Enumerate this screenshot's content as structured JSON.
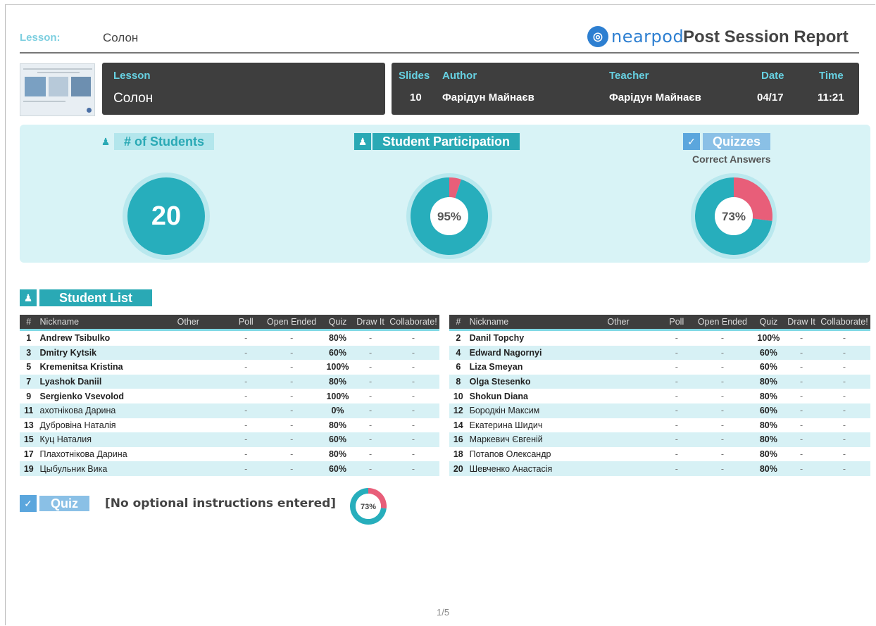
{
  "header": {
    "lesson_label": "Lesson:",
    "lesson_value": "Солон",
    "brand": "nearpod",
    "report_title": "Post Session Report"
  },
  "info": {
    "lesson_label": "Lesson",
    "lesson_value": "Солон",
    "slides_label": "Slides",
    "slides_value": "10",
    "author_label": "Author",
    "author_value": "Фарідун Майнаєв",
    "teacher_label": "Teacher",
    "teacher_value": "Фарідун Майнаєв",
    "date_label": "Date",
    "date_value": "04/17",
    "time_label": "Time",
    "time_value": "11:21"
  },
  "stats": {
    "students_label": "# of Students",
    "students_value": "20",
    "participation_label": "Student Participation",
    "participation_text": "95%",
    "participation_fraction": 0.95,
    "quizzes_label": "Quizzes",
    "quizzes_sub": "Correct Answers",
    "quizzes_text": "73%",
    "quizzes_fraction": 0.73
  },
  "colors": {
    "teal": "#2aa9b5",
    "pink": "#e85e79",
    "dark": "#3e3e3e",
    "light_teal": "#d8f3f6",
    "brand_blue": "#2d7fd1"
  },
  "student_list": {
    "title": "Student List",
    "columns": [
      "#",
      "Nickname",
      "Other",
      "Poll",
      "Open Ended",
      "Quiz",
      "Draw It",
      "Collaborate!"
    ],
    "left": [
      {
        "num": "1",
        "name": "Andrew Tsibulko",
        "bold": true,
        "other": "",
        "poll": "-",
        "open": "-",
        "quiz": "80%",
        "draw": "-",
        "collab": "-"
      },
      {
        "num": "3",
        "name": "Dmitry Kytsik",
        "bold": true,
        "other": "",
        "poll": "-",
        "open": "-",
        "quiz": "60%",
        "draw": "-",
        "collab": "-"
      },
      {
        "num": "5",
        "name": "Kremenitsa Kristina",
        "bold": true,
        "other": "",
        "poll": "-",
        "open": "-",
        "quiz": "100%",
        "draw": "-",
        "collab": "-"
      },
      {
        "num": "7",
        "name": "Lyashok Daniil",
        "bold": true,
        "other": "",
        "poll": "-",
        "open": "-",
        "quiz": "80%",
        "draw": "-",
        "collab": "-"
      },
      {
        "num": "9",
        "name": "Sergienko Vsevolod",
        "bold": true,
        "other": "",
        "poll": "-",
        "open": "-",
        "quiz": "100%",
        "draw": "-",
        "collab": "-"
      },
      {
        "num": "11",
        "name": "ахотнікова Дарина",
        "bold": false,
        "other": "",
        "poll": "-",
        "open": "-",
        "quiz": "0%",
        "draw": "-",
        "collab": "-"
      },
      {
        "num": "13",
        "name": "Дубровіна Наталія",
        "bold": false,
        "other": "",
        "poll": "-",
        "open": "-",
        "quiz": "80%",
        "draw": "-",
        "collab": "-"
      },
      {
        "num": "15",
        "name": "Куц Наталия",
        "bold": false,
        "other": "",
        "poll": "-",
        "open": "-",
        "quiz": "60%",
        "draw": "-",
        "collab": "-"
      },
      {
        "num": "17",
        "name": "Плахотнікова Дарина",
        "bold": false,
        "other": "",
        "poll": "-",
        "open": "-",
        "quiz": "80%",
        "draw": "-",
        "collab": "-"
      },
      {
        "num": "19",
        "name": "Цыбульник Вика",
        "bold": false,
        "other": "",
        "poll": "-",
        "open": "-",
        "quiz": "60%",
        "draw": "-",
        "collab": "-"
      }
    ],
    "right": [
      {
        "num": "2",
        "name": "Danil Topchy",
        "bold": true,
        "other": "",
        "poll": "-",
        "open": "-",
        "quiz": "100%",
        "draw": "-",
        "collab": "-"
      },
      {
        "num": "4",
        "name": "Edward Nagornyi",
        "bold": true,
        "other": "",
        "poll": "-",
        "open": "-",
        "quiz": "60%",
        "draw": "-",
        "collab": "-"
      },
      {
        "num": "6",
        "name": "Liza Smeyan",
        "bold": true,
        "other": "",
        "poll": "-",
        "open": "-",
        "quiz": "60%",
        "draw": "-",
        "collab": "-"
      },
      {
        "num": "8",
        "name": "Olga Stesenko",
        "bold": true,
        "other": "",
        "poll": "-",
        "open": "-",
        "quiz": "80%",
        "draw": "-",
        "collab": "-"
      },
      {
        "num": "10",
        "name": "Shokun Diana",
        "bold": true,
        "other": "",
        "poll": "-",
        "open": "-",
        "quiz": "80%",
        "draw": "-",
        "collab": "-"
      },
      {
        "num": "12",
        "name": "Бородкін Максим",
        "bold": false,
        "other": "",
        "poll": "-",
        "open": "-",
        "quiz": "60%",
        "draw": "-",
        "collab": "-"
      },
      {
        "num": "14",
        "name": "Екатерина Шидич",
        "bold": false,
        "other": "",
        "poll": "-",
        "open": "-",
        "quiz": "80%",
        "draw": "-",
        "collab": "-"
      },
      {
        "num": "16",
        "name": "Маркевич Євгеній",
        "bold": false,
        "other": "",
        "poll": "-",
        "open": "-",
        "quiz": "80%",
        "draw": "-",
        "collab": "-"
      },
      {
        "num": "18",
        "name": "Потапов Олександр",
        "bold": false,
        "other": "",
        "poll": "-",
        "open": "-",
        "quiz": "80%",
        "draw": "-",
        "collab": "-"
      },
      {
        "num": "20",
        "name": "Шевченко Анастасія",
        "bold": false,
        "other": "",
        "poll": "-",
        "open": "-",
        "quiz": "80%",
        "draw": "-",
        "collab": "-"
      }
    ]
  },
  "quiz_section": {
    "label": "Quiz",
    "instructions": "[No optional instructions entered]",
    "score_text": "73%",
    "score_fraction": 0.73
  },
  "footer": {
    "page": "1/5"
  }
}
